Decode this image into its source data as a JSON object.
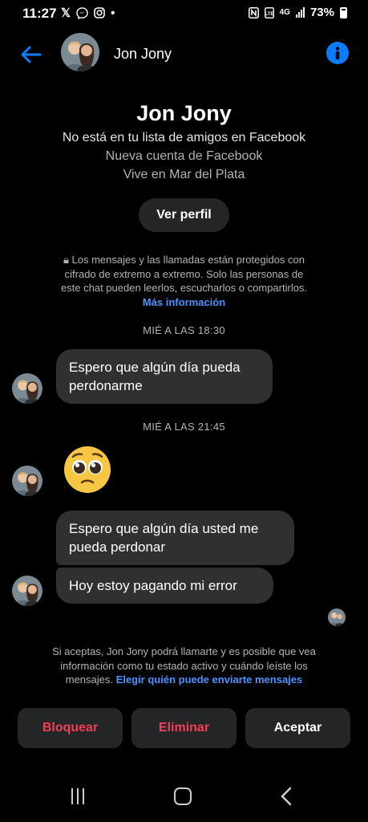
{
  "status_bar": {
    "time": "11:27",
    "network": "4G",
    "battery": "73%"
  },
  "header": {
    "contact_name": "Jon Jony"
  },
  "profile": {
    "name": "Jon Jony",
    "relation": "No está en tu lista de amigos en Facebook",
    "account_note": "Nueva cuenta de Facebook",
    "location": "Vive en Mar del Plata",
    "view_profile_label": "Ver perfil"
  },
  "encryption": {
    "text": "Los mensajes y las llamadas están protegidos con cifrado de extremo a extremo. Solo las personas de este chat pueden leerlos, escucharlos o compartirlos.",
    "link": "Más información"
  },
  "messages": {
    "timestamp_1": "MIÉ A LAS 18:30",
    "msg_1": "Espero que algún día pueda perdonarme",
    "timestamp_2": "MIÉ A LAS 21:45",
    "msg_2_emoji": "🥺",
    "msg_3": "Espero que algún día usted me pueda perdonar",
    "msg_4": "Hoy estoy pagando mi error"
  },
  "request": {
    "text": "Si aceptas, Jon Jony podrá llamarte y es posible que vea información como tu estado activo y cuándo leíste los mensajes.",
    "link": "Elegir quién puede enviarte mensajes"
  },
  "actions": {
    "block": "Bloquear",
    "delete": "Eliminar",
    "accept": "Aceptar"
  },
  "colors": {
    "accent": "#0a7cff",
    "link": "#4c93ff",
    "danger": "#f33e58",
    "bubble": "#303030",
    "button_bg": "#242526"
  }
}
